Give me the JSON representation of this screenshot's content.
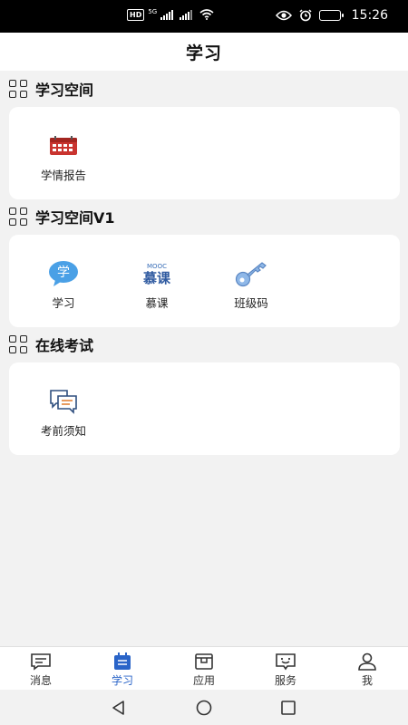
{
  "status_bar": {
    "network_badge": "HD",
    "signal_label": "5G",
    "time": "15:26"
  },
  "header": {
    "title": "学习"
  },
  "sections": [
    {
      "title": "学习空间",
      "items": [
        {
          "label": "学情报告",
          "icon": "calendar-report-icon"
        }
      ]
    },
    {
      "title": "学习空间V1",
      "items": [
        {
          "label": "学习",
          "icon": "study-chat-bubble-icon",
          "glyph": "学"
        },
        {
          "label": "慕课",
          "icon": "mooc-logo-icon",
          "logo_small": "MOOC",
          "logo_big": "慕课"
        },
        {
          "label": "班级码",
          "icon": "key-icon"
        }
      ]
    },
    {
      "title": "在线考试",
      "items": [
        {
          "label": "考前须知",
          "icon": "chat-bubbles-icon"
        }
      ]
    }
  ],
  "tabbar": {
    "items": [
      {
        "label": "消息",
        "icon": "message-icon",
        "active": false
      },
      {
        "label": "学习",
        "icon": "study-icon",
        "active": true
      },
      {
        "label": "应用",
        "icon": "apps-icon",
        "active": false
      },
      {
        "label": "服务",
        "icon": "service-icon",
        "active": false
      },
      {
        "label": "我",
        "icon": "profile-icon",
        "active": false
      }
    ]
  },
  "colors": {
    "accent": "#2a64c8",
    "background": "#f2f2f2",
    "card": "#ffffff"
  }
}
